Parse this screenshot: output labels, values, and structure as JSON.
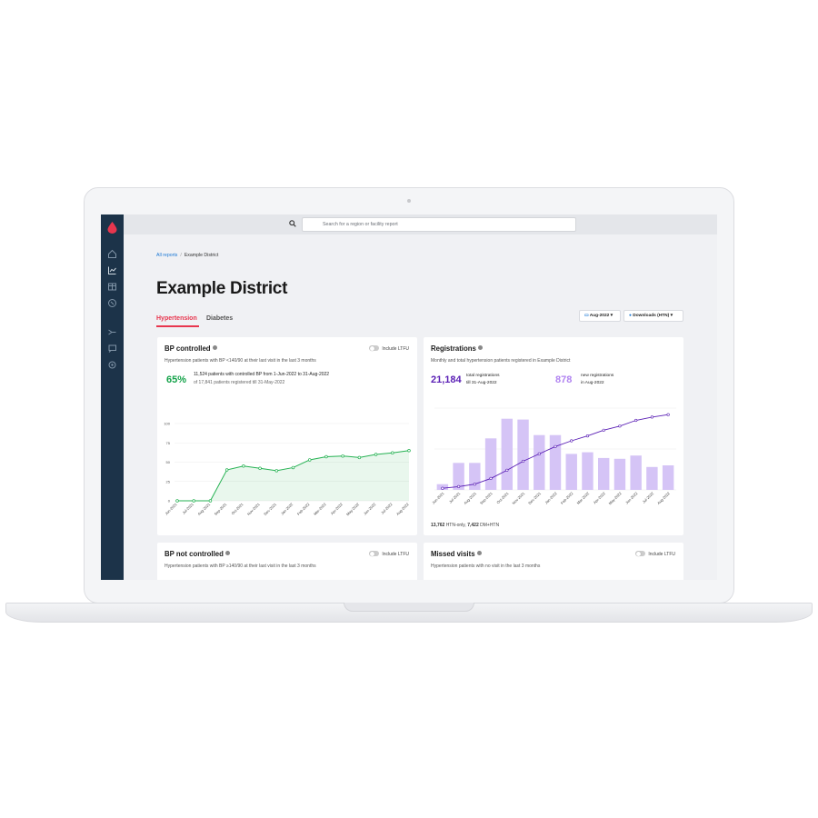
{
  "search": {
    "placeholder": "Search for a region or facility report"
  },
  "breadcrumb": {
    "link": "All reports",
    "current": "Example District"
  },
  "page_title": "Example District",
  "tabs": [
    {
      "label": "Hypertension",
      "active": true
    },
    {
      "label": "Diabetes",
      "active": false
    }
  ],
  "controls": {
    "date_label": "Aug-2022",
    "downloads_label": "Downloads (HTN)"
  },
  "sidebar": {
    "icons": [
      "home-icon",
      "chart-icon",
      "table-icon",
      "phone-icon",
      "merge-icon",
      "chat-icon",
      "gear-icon"
    ]
  },
  "bp_controlled": {
    "title": "BP controlled",
    "subtitle": "Hypertension patients with BP <140/90 at their last visit in the last 3 months",
    "toggle_label": "Include LTFU",
    "percent": "65%",
    "stat_line1": "11,524 patients with controlled BP from 1-Jun-2022 to 31-Aug-2022",
    "stat_line2": "of 17,841 patients registered till 31-May-2022"
  },
  "registrations": {
    "title": "Registrations",
    "subtitle": "Monthly and total hypertension patients registered in Example District",
    "total": "21,184",
    "total_label_1": "total registrations",
    "total_label_2": "till 31-Aug-2022",
    "new": "878",
    "new_label_1": "new registrations",
    "new_label_2": "in Aug-2022",
    "foot_htn": "13,762",
    "foot_htn_label": "HTN-only,",
    "foot_dm": "7,422",
    "foot_dm_label": "DM+HTN"
  },
  "bp_not_controlled": {
    "title": "BP not controlled",
    "subtitle": "Hypertension patients with BP ≥140/90 at their last visit in the last 3 months",
    "toggle_label": "Include LTFU"
  },
  "missed_visits": {
    "title": "Missed visits",
    "subtitle": "Hypertension patients with no visit in the last 3 months",
    "toggle_label": "Include LTFU"
  },
  "chart_data": [
    {
      "type": "area",
      "categories": [
        "Jun-2021",
        "Jul-2021",
        "Aug-2021",
        "Sep-2021",
        "Oct-2021",
        "Nov-2021",
        "Dec-2021",
        "Jan-2022",
        "Feb-2022",
        "Mar-2022",
        "Apr-2022",
        "May-2022",
        "Jun-2022",
        "Jul-2022",
        "Aug-2022"
      ],
      "values": [
        0,
        0,
        0,
        40,
        45,
        42,
        39,
        43,
        53,
        57,
        58,
        56,
        60,
        62,
        65
      ],
      "ylim": [
        0,
        100
      ],
      "yticks": [
        0,
        25,
        50,
        75,
        100
      ],
      "color": "#26b253",
      "grid": true
    },
    {
      "type": "bar",
      "categories": [
        "Jun-2021",
        "Jul-2021",
        "Aug-2021",
        "Sep-2021",
        "Oct-2021",
        "Nov-2021",
        "Dec-2021",
        "Jan-2022",
        "Feb-2022",
        "Mar-2022",
        "Apr-2022",
        "May-2022",
        "Jun-2022",
        "Jul-2022",
        "Aug-2022"
      ],
      "series": [
        {
          "values": [
            7,
            33,
            33,
            63,
            87,
            86,
            67,
            67,
            44,
            46,
            39,
            38,
            42,
            28,
            30
          ],
          "color": "#d5c4f6"
        },
        {
          "values": [
            2,
            4,
            7,
            14,
            24,
            35,
            44,
            53,
            60,
            66,
            73,
            78,
            85,
            89,
            92
          ],
          "color": "#5a1fb5"
        }
      ],
      "grid": true
    }
  ]
}
